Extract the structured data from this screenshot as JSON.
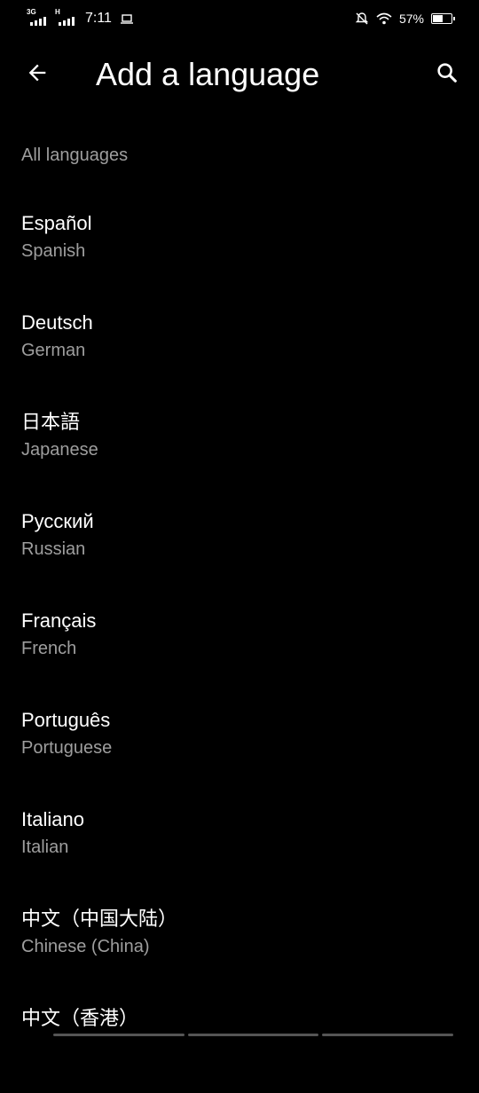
{
  "status_bar": {
    "network1": "3G",
    "network2": "H",
    "time": "7:11",
    "battery_percent": "57%",
    "battery_level": 0.57
  },
  "app_bar": {
    "title": "Add a language",
    "back_icon": "arrow-back-icon",
    "search_icon": "search-icon"
  },
  "section_header": "All languages",
  "languages": [
    {
      "name": "Español",
      "english": "Spanish"
    },
    {
      "name": "Deutsch",
      "english": "German"
    },
    {
      "name": "日本語",
      "english": "Japanese"
    },
    {
      "name": "Русский",
      "english": "Russian"
    },
    {
      "name": "Français",
      "english": "French"
    },
    {
      "name": "Português",
      "english": "Portuguese"
    },
    {
      "name": "Italiano",
      "english": "Italian"
    },
    {
      "name": "中文（中国大陆）",
      "english": "Chinese (China)"
    },
    {
      "name": "中文（香港）",
      "english": ""
    }
  ],
  "colors": {
    "background": "#000000",
    "primary_text": "#ffffff",
    "secondary_text": "#9e9e9e"
  }
}
